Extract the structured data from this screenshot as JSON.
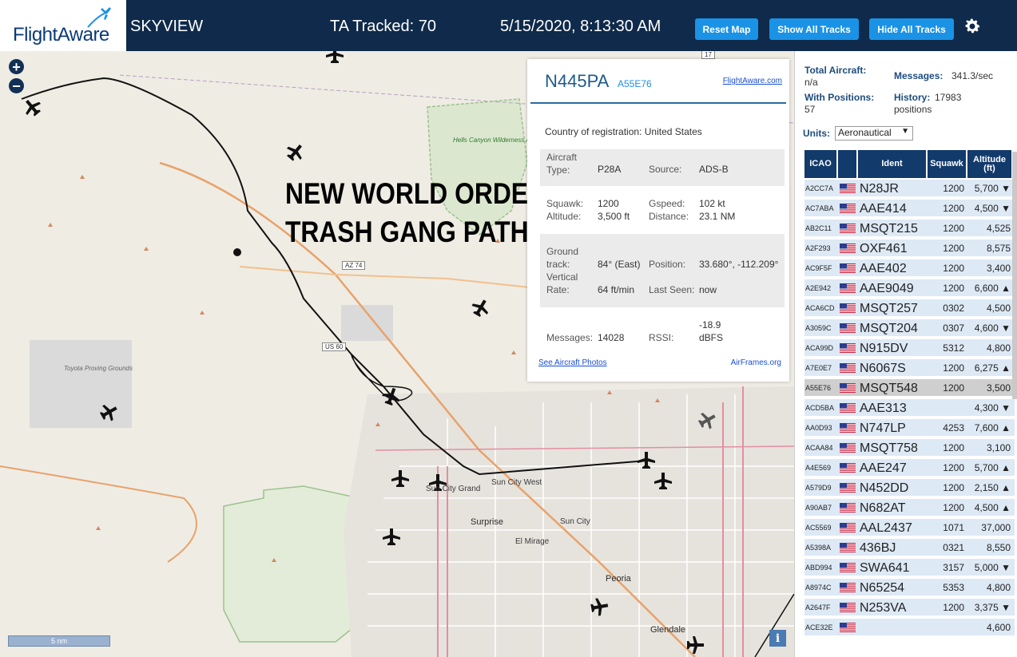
{
  "header": {
    "logo": "FlightAware",
    "app_title": "SKYVIEW",
    "tracked": "TA Tracked: 70",
    "datetime": "5/15/2020, 8:13:30 AM",
    "reset_map": "Reset Map",
    "show_all": "Show All Tracks",
    "hide_all": "Hide All Tracks",
    "settings_icon": "gear-icon"
  },
  "map": {
    "zoom_in": "+",
    "zoom_out": "−",
    "overlay_line1": "NEW WORLD ORDER",
    "overlay_line2": "TRASH GANG PATH",
    "scale": "5 nm",
    "info": "i",
    "labels": {
      "hells_canyon": "Hells Canyon Wilderness Area",
      "toyota": "Toyota Proving Grounds",
      "sun_city_grand": "Sun City Grand",
      "sun_city_west": "Sun City West",
      "surprise": "Surprise",
      "sun_city": "Sun City",
      "el_mirage": "El Mirage",
      "peoria": "Peoria",
      "glendale": "Glendale",
      "az74": "AZ 74",
      "us60": "US 60",
      "r17": "17"
    }
  },
  "popup": {
    "ident": "N445PA",
    "icao": "A55E76",
    "link": "FlightAware.com",
    "country_label": "Country of registration:",
    "country": "United States",
    "aircraft_type_label": "Aircraft Type:",
    "aircraft_type": "P28A",
    "source_label": "Source:",
    "source": "ADS-B",
    "squawk_label": "Squawk:",
    "squawk": "1200",
    "gspeed_label": "Gspeed:",
    "gspeed": "102 kt",
    "altitude_label": "Altitude:",
    "altitude": "3,500 ft",
    "distance_label": "Distance:",
    "distance": "23.1 NM",
    "ground_track_label": "Ground track:",
    "ground_track": "84° (East)",
    "position_label": "Position:",
    "position": "33.680°, -112.209°",
    "vertical_rate_label": "Vertical Rate:",
    "vertical_rate": "64 ft/min",
    "last_seen_label": "Last Seen:",
    "last_seen": "now",
    "messages_label": "Messages:",
    "messages": "14028",
    "rssi_label": "RSSI:",
    "rssi": "-18.9 dBFS",
    "photos_link": "See Aircraft Photos",
    "airframes_link": "AirFrames.org"
  },
  "sidebar": {
    "total_aircraft_label": "Total Aircraft:",
    "total_aircraft": "n/a",
    "with_positions_label": "With Positions:",
    "with_positions": "57",
    "messages_label": "Messages:",
    "messages": "341.3/sec",
    "history_label": "History:",
    "history": "17983 positions",
    "units_label": "Units:",
    "units_value": "Aeronautical",
    "columns": {
      "icao": "ICAO",
      "ident": "Ident",
      "squawk": "Squawk",
      "altitude": "Altitude (ft)"
    },
    "rows": [
      {
        "icao": "A2CC7A",
        "ident": "N28JR",
        "squawk": "1200",
        "alt": "5,700 ▼"
      },
      {
        "icao": "AC7ABA",
        "ident": "AAE414",
        "squawk": "1200",
        "alt": "4,500 ▼"
      },
      {
        "icao": "AB2C11",
        "ident": "MSQT215",
        "squawk": "1200",
        "alt": "4,525"
      },
      {
        "icao": "A2F293",
        "ident": "OXF461",
        "squawk": "1200",
        "alt": "8,575"
      },
      {
        "icao": "AC9F5F",
        "ident": "AAE402",
        "squawk": "1200",
        "alt": "3,400"
      },
      {
        "icao": "A2E942",
        "ident": "AAE9049",
        "squawk": "1200",
        "alt": "6,600 ▲"
      },
      {
        "icao": "ACA6CD",
        "ident": "MSQT257",
        "squawk": "0302",
        "alt": "4,500"
      },
      {
        "icao": "A3059C",
        "ident": "MSQT204",
        "squawk": "0307",
        "alt": "4,600 ▼"
      },
      {
        "icao": "ACA99D",
        "ident": "N915DV",
        "squawk": "5312",
        "alt": "4,800"
      },
      {
        "icao": "A7E0E7",
        "ident": "N6067S",
        "squawk": "1200",
        "alt": "6,275 ▲"
      },
      {
        "icao": "A55E76",
        "ident": "MSQT548",
        "squawk": "1200",
        "alt": "3,500"
      },
      {
        "icao": "ACD5BA",
        "ident": "AAE313",
        "squawk": "",
        "alt": "4,300 ▼"
      },
      {
        "icao": "AA0D93",
        "ident": "N747LP",
        "squawk": "4253",
        "alt": "7,600 ▲"
      },
      {
        "icao": "ACAA84",
        "ident": "MSQT758",
        "squawk": "1200",
        "alt": "3,100"
      },
      {
        "icao": "A4E569",
        "ident": "AAE247",
        "squawk": "1200",
        "alt": "5,700 ▲"
      },
      {
        "icao": "A579D9",
        "ident": "N452DD",
        "squawk": "1200",
        "alt": "2,150 ▲"
      },
      {
        "icao": "A90AB7",
        "ident": "N682AT",
        "squawk": "1200",
        "alt": "4,500 ▲"
      },
      {
        "icao": "AC5569",
        "ident": "AAL2437",
        "squawk": "1071",
        "alt": "37,000"
      },
      {
        "icao": "A5398A",
        "ident": "436BJ",
        "squawk": "0321",
        "alt": "8,550"
      },
      {
        "icao": "ABD994",
        "ident": "SWA641",
        "squawk": "3157",
        "alt": "5,000 ▼"
      },
      {
        "icao": "A8974C",
        "ident": "N65254",
        "squawk": "5353",
        "alt": "4,800"
      },
      {
        "icao": "A2647F",
        "ident": "N253VA",
        "squawk": "1200",
        "alt": "3,375 ▼"
      },
      {
        "icao": "ACE32E",
        "ident": "",
        "squawk": "",
        "alt": "4,600"
      }
    ]
  }
}
